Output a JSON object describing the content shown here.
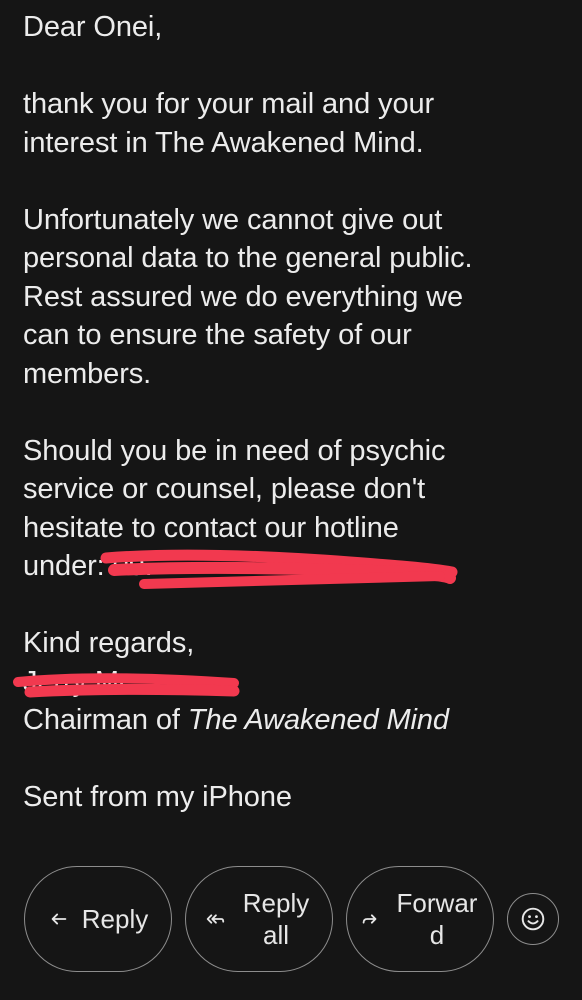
{
  "email": {
    "greeting": "Dear Onei,",
    "paragraph1": [
      "thank you for your mail and your",
      "interest in The Awakened Mind."
    ],
    "paragraph2": [
      "Unfortunately we cannot give out",
      "personal data to the general public.",
      "Rest assured we do everything we",
      "can to ensure the safety of our",
      "members."
    ],
    "paragraph3": [
      "Should you be in need of psychic",
      "service or counsel, please don't",
      "hesitate to contact our hotline"
    ],
    "hotline_prefix": "under: ",
    "hotline_number_partial": "09.",
    "closing": "Kind regards,",
    "signer_name_partial": "Jerry Mc",
    "title_prefix": "Chairman of ",
    "title_org": "The Awakened Mind",
    "signature": "Sent from my iPhone"
  },
  "actions": {
    "reply_label": "Reply",
    "reply_all_label": "Reply all",
    "forward_label": "Forward"
  },
  "colors": {
    "background": "#151515",
    "text": "#ececec",
    "redaction": "#f2394f",
    "button_border": "#8d8d8d"
  },
  "icons": {
    "reply": "reply-arrow-icon",
    "reply_all": "reply-all-arrow-icon",
    "forward": "forward-arrow-icon",
    "emoji": "emoji-smile-icon"
  }
}
